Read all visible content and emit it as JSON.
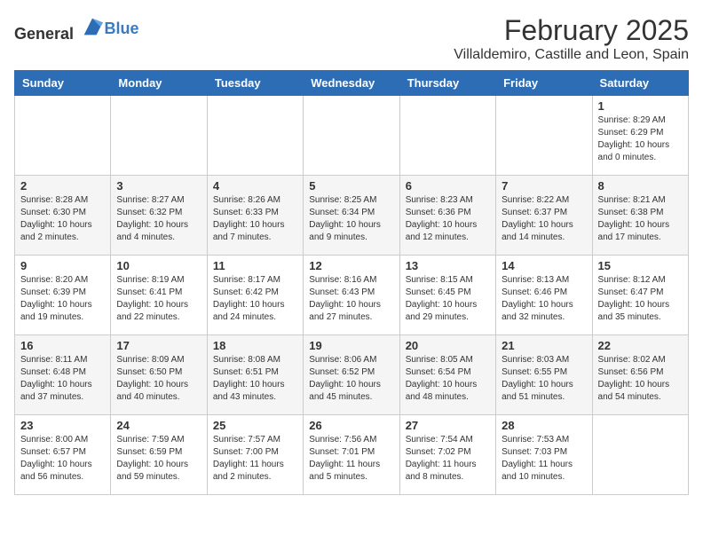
{
  "logo": {
    "text_general": "General",
    "text_blue": "Blue"
  },
  "title": "February 2025",
  "subtitle": "Villaldemiro, Castille and Leon, Spain",
  "weekdays": [
    "Sunday",
    "Monday",
    "Tuesday",
    "Wednesday",
    "Thursday",
    "Friday",
    "Saturday"
  ],
  "weeks": [
    [
      {
        "day": "",
        "info": ""
      },
      {
        "day": "",
        "info": ""
      },
      {
        "day": "",
        "info": ""
      },
      {
        "day": "",
        "info": ""
      },
      {
        "day": "",
        "info": ""
      },
      {
        "day": "",
        "info": ""
      },
      {
        "day": "1",
        "info": "Sunrise: 8:29 AM\nSunset: 6:29 PM\nDaylight: 10 hours\nand 0 minutes."
      }
    ],
    [
      {
        "day": "2",
        "info": "Sunrise: 8:28 AM\nSunset: 6:30 PM\nDaylight: 10 hours\nand 2 minutes."
      },
      {
        "day": "3",
        "info": "Sunrise: 8:27 AM\nSunset: 6:32 PM\nDaylight: 10 hours\nand 4 minutes."
      },
      {
        "day": "4",
        "info": "Sunrise: 8:26 AM\nSunset: 6:33 PM\nDaylight: 10 hours\nand 7 minutes."
      },
      {
        "day": "5",
        "info": "Sunrise: 8:25 AM\nSunset: 6:34 PM\nDaylight: 10 hours\nand 9 minutes."
      },
      {
        "day": "6",
        "info": "Sunrise: 8:23 AM\nSunset: 6:36 PM\nDaylight: 10 hours\nand 12 minutes."
      },
      {
        "day": "7",
        "info": "Sunrise: 8:22 AM\nSunset: 6:37 PM\nDaylight: 10 hours\nand 14 minutes."
      },
      {
        "day": "8",
        "info": "Sunrise: 8:21 AM\nSunset: 6:38 PM\nDaylight: 10 hours\nand 17 minutes."
      }
    ],
    [
      {
        "day": "9",
        "info": "Sunrise: 8:20 AM\nSunset: 6:39 PM\nDaylight: 10 hours\nand 19 minutes."
      },
      {
        "day": "10",
        "info": "Sunrise: 8:19 AM\nSunset: 6:41 PM\nDaylight: 10 hours\nand 22 minutes."
      },
      {
        "day": "11",
        "info": "Sunrise: 8:17 AM\nSunset: 6:42 PM\nDaylight: 10 hours\nand 24 minutes."
      },
      {
        "day": "12",
        "info": "Sunrise: 8:16 AM\nSunset: 6:43 PM\nDaylight: 10 hours\nand 27 minutes."
      },
      {
        "day": "13",
        "info": "Sunrise: 8:15 AM\nSunset: 6:45 PM\nDaylight: 10 hours\nand 29 minutes."
      },
      {
        "day": "14",
        "info": "Sunrise: 8:13 AM\nSunset: 6:46 PM\nDaylight: 10 hours\nand 32 minutes."
      },
      {
        "day": "15",
        "info": "Sunrise: 8:12 AM\nSunset: 6:47 PM\nDaylight: 10 hours\nand 35 minutes."
      }
    ],
    [
      {
        "day": "16",
        "info": "Sunrise: 8:11 AM\nSunset: 6:48 PM\nDaylight: 10 hours\nand 37 minutes."
      },
      {
        "day": "17",
        "info": "Sunrise: 8:09 AM\nSunset: 6:50 PM\nDaylight: 10 hours\nand 40 minutes."
      },
      {
        "day": "18",
        "info": "Sunrise: 8:08 AM\nSunset: 6:51 PM\nDaylight: 10 hours\nand 43 minutes."
      },
      {
        "day": "19",
        "info": "Sunrise: 8:06 AM\nSunset: 6:52 PM\nDaylight: 10 hours\nand 45 minutes."
      },
      {
        "day": "20",
        "info": "Sunrise: 8:05 AM\nSunset: 6:54 PM\nDaylight: 10 hours\nand 48 minutes."
      },
      {
        "day": "21",
        "info": "Sunrise: 8:03 AM\nSunset: 6:55 PM\nDaylight: 10 hours\nand 51 minutes."
      },
      {
        "day": "22",
        "info": "Sunrise: 8:02 AM\nSunset: 6:56 PM\nDaylight: 10 hours\nand 54 minutes."
      }
    ],
    [
      {
        "day": "23",
        "info": "Sunrise: 8:00 AM\nSunset: 6:57 PM\nDaylight: 10 hours\nand 56 minutes."
      },
      {
        "day": "24",
        "info": "Sunrise: 7:59 AM\nSunset: 6:59 PM\nDaylight: 10 hours\nand 59 minutes."
      },
      {
        "day": "25",
        "info": "Sunrise: 7:57 AM\nSunset: 7:00 PM\nDaylight: 11 hours\nand 2 minutes."
      },
      {
        "day": "26",
        "info": "Sunrise: 7:56 AM\nSunset: 7:01 PM\nDaylight: 11 hours\nand 5 minutes."
      },
      {
        "day": "27",
        "info": "Sunrise: 7:54 AM\nSunset: 7:02 PM\nDaylight: 11 hours\nand 8 minutes."
      },
      {
        "day": "28",
        "info": "Sunrise: 7:53 AM\nSunset: 7:03 PM\nDaylight: 11 hours\nand 10 minutes."
      },
      {
        "day": "",
        "info": ""
      }
    ]
  ]
}
